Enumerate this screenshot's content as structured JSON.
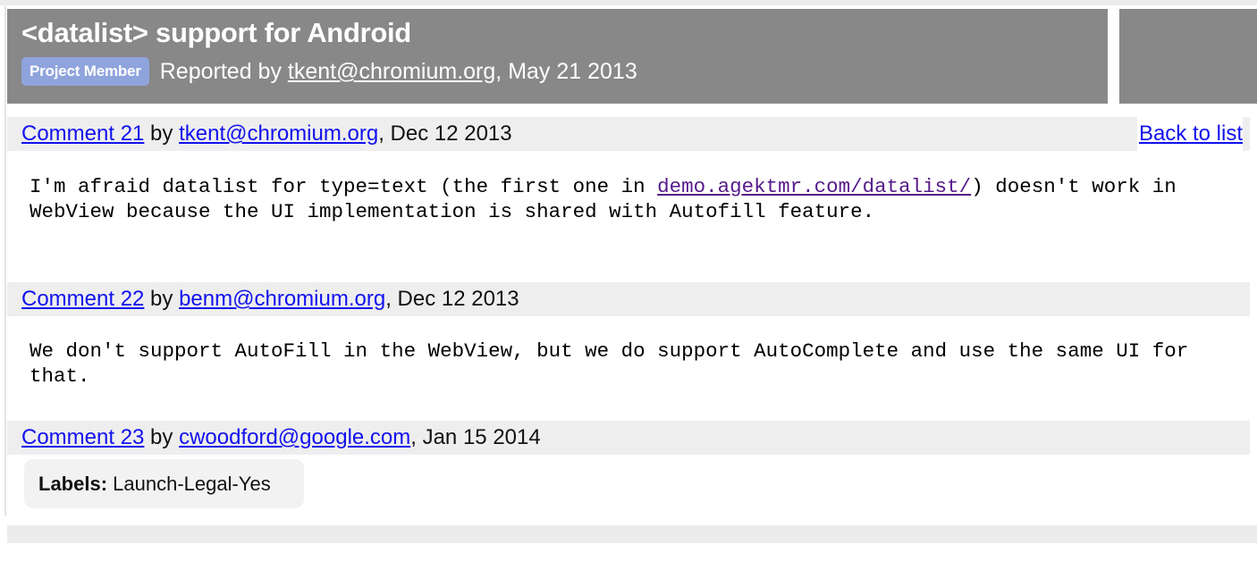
{
  "issue": {
    "title": "<datalist> support for Android",
    "badge": "Project Member",
    "reported_prefix": "Reported by ",
    "reporter": "tkent@chromium.org",
    "reported_suffix": ", May 21 2013"
  },
  "back_to_list": "Back to list",
  "comments": [
    {
      "link": "Comment 21",
      "by": " by ",
      "author": "tkent@chromium.org",
      "date": ", Dec 12 2013",
      "body_before": "I'm afraid datalist for type=text (the first one in ",
      "body_link": "demo.agektmr.com/datalist/",
      "body_after": ") doesn't work in\nWebView because the UI implementation is shared with Autofill feature."
    },
    {
      "link": "Comment 22",
      "by": " by ",
      "author": "benm@chromium.org",
      "date": ", Dec 12 2013",
      "body_before": "We don't support AutoFill in the WebView, but we do support AutoComplete and use the same UI for\nthat.",
      "body_link": "",
      "body_after": ""
    },
    {
      "link": "Comment 23",
      "by": " by ",
      "author": "cwoodford@google.com",
      "date": ", Jan 15 2014",
      "body_before": "",
      "body_link": "",
      "body_after": ""
    }
  ],
  "labels": {
    "key": "Labels:",
    "value": " Launch-Legal-Yes"
  },
  "colors": {
    "header_bg": "#888888",
    "badge_bg": "#8fa4dd",
    "comment_head_bg": "#eeeeee",
    "link": "#1111ee",
    "visited_link": "#551a8b",
    "labels_bg": "#f2f2f2"
  }
}
